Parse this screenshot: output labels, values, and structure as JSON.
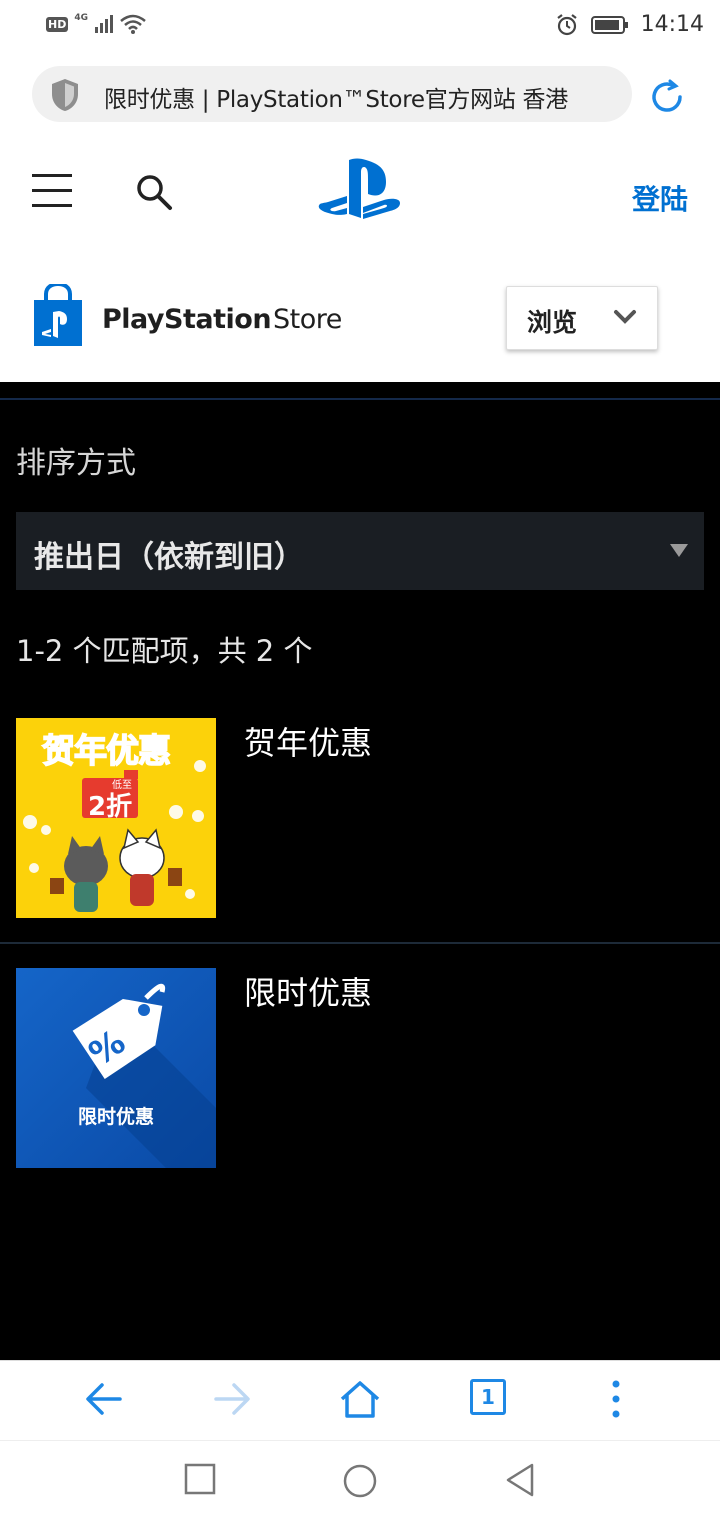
{
  "status_bar": {
    "hd": "HD",
    "network": "4G",
    "time": "14:14"
  },
  "browser": {
    "url_title": "限时优惠 | PlayStation™Store官方网站 香港"
  },
  "header": {
    "login_label": "登陆"
  },
  "store": {
    "brand_bold": "PlayStation",
    "brand_light": "Store",
    "browse_label": "浏览"
  },
  "sort": {
    "label": "排序方式",
    "selected": "推出日（依新到旧）"
  },
  "results": {
    "count_text": "1-2 个匹配项，共 2 个",
    "items": [
      {
        "title": "贺年优惠",
        "thumb_headline": "贺年优惠",
        "thumb_badge": "2折",
        "thumb_badge_small": "低至"
      },
      {
        "title": "限时优惠",
        "thumb_caption": "限时优惠"
      }
    ]
  },
  "nav": {
    "tab_count": "1"
  },
  "colors": {
    "ps_blue": "#0070d1",
    "dark_bg": "#000000",
    "select_bg": "#1a1e23"
  }
}
